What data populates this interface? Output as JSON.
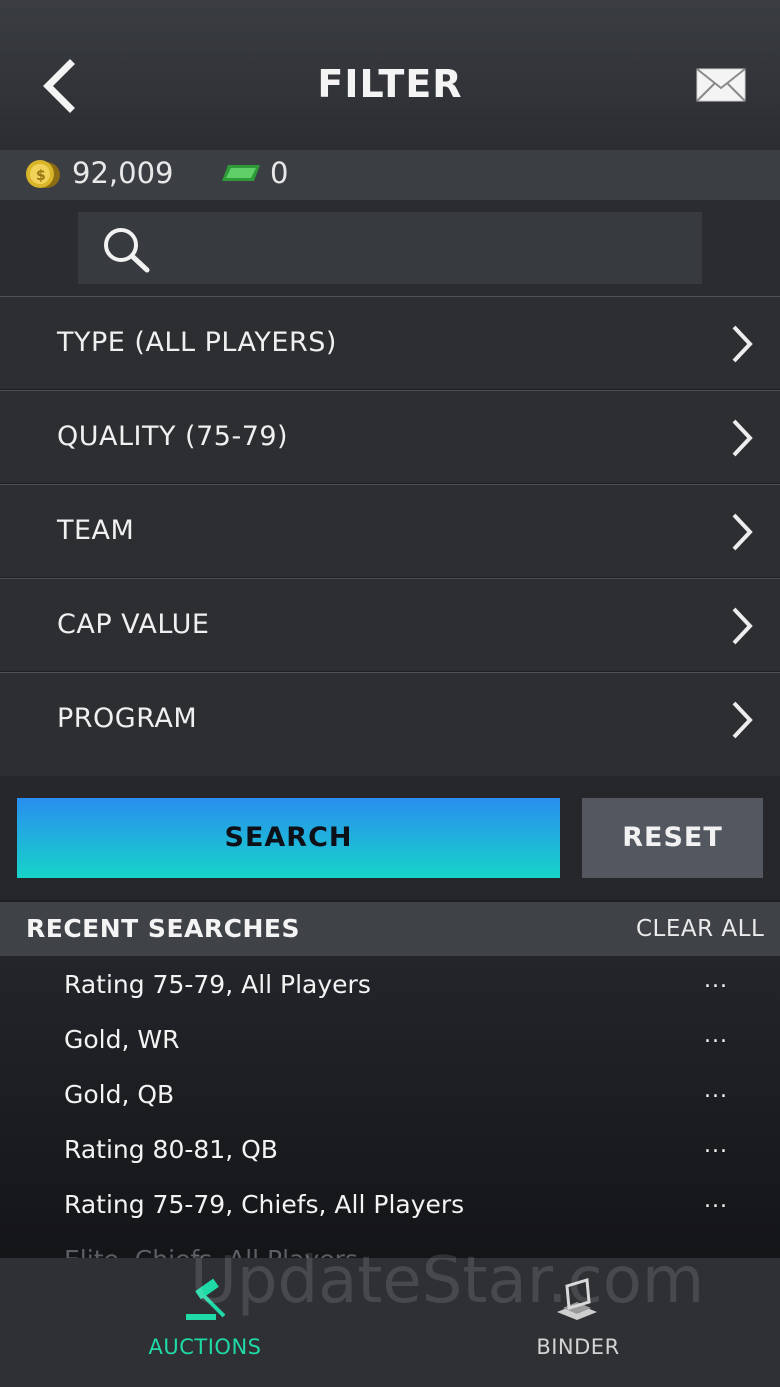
{
  "header": {
    "title": "FILTER"
  },
  "currency": {
    "coins": "92,009",
    "cash": "0"
  },
  "search": {
    "placeholder": ""
  },
  "filters": [
    {
      "label": "TYPE (ALL PLAYERS)"
    },
    {
      "label": "QUALITY (75-79)"
    },
    {
      "label": "TEAM"
    },
    {
      "label": "CAP VALUE"
    },
    {
      "label": "PROGRAM"
    }
  ],
  "buttons": {
    "search_label": "SEARCH",
    "reset_label": "RESET"
  },
  "recent": {
    "title": "RECENT SEARCHES",
    "clear_label": "CLEAR ALL",
    "more_label": "...",
    "items": [
      {
        "text": "Rating 75-79, All Players"
      },
      {
        "text": "Gold, WR"
      },
      {
        "text": "Gold, QB"
      },
      {
        "text": "Rating 80-81, QB"
      },
      {
        "text": "Rating 75-79, Chiefs, All Players"
      },
      {
        "text": "Elite, Chiefs, All Players"
      }
    ]
  },
  "tabs": [
    {
      "label": "AUCTIONS",
      "icon": "gavel-icon",
      "active": true
    },
    {
      "label": "BINDER",
      "icon": "binder-icon",
      "active": false
    }
  ],
  "watermark": "UpdateStar.com",
  "colors": {
    "accent": "#1fd9a6",
    "search_gradient_top": "#2a8ef0",
    "search_gradient_bottom": "#16d4c8"
  }
}
